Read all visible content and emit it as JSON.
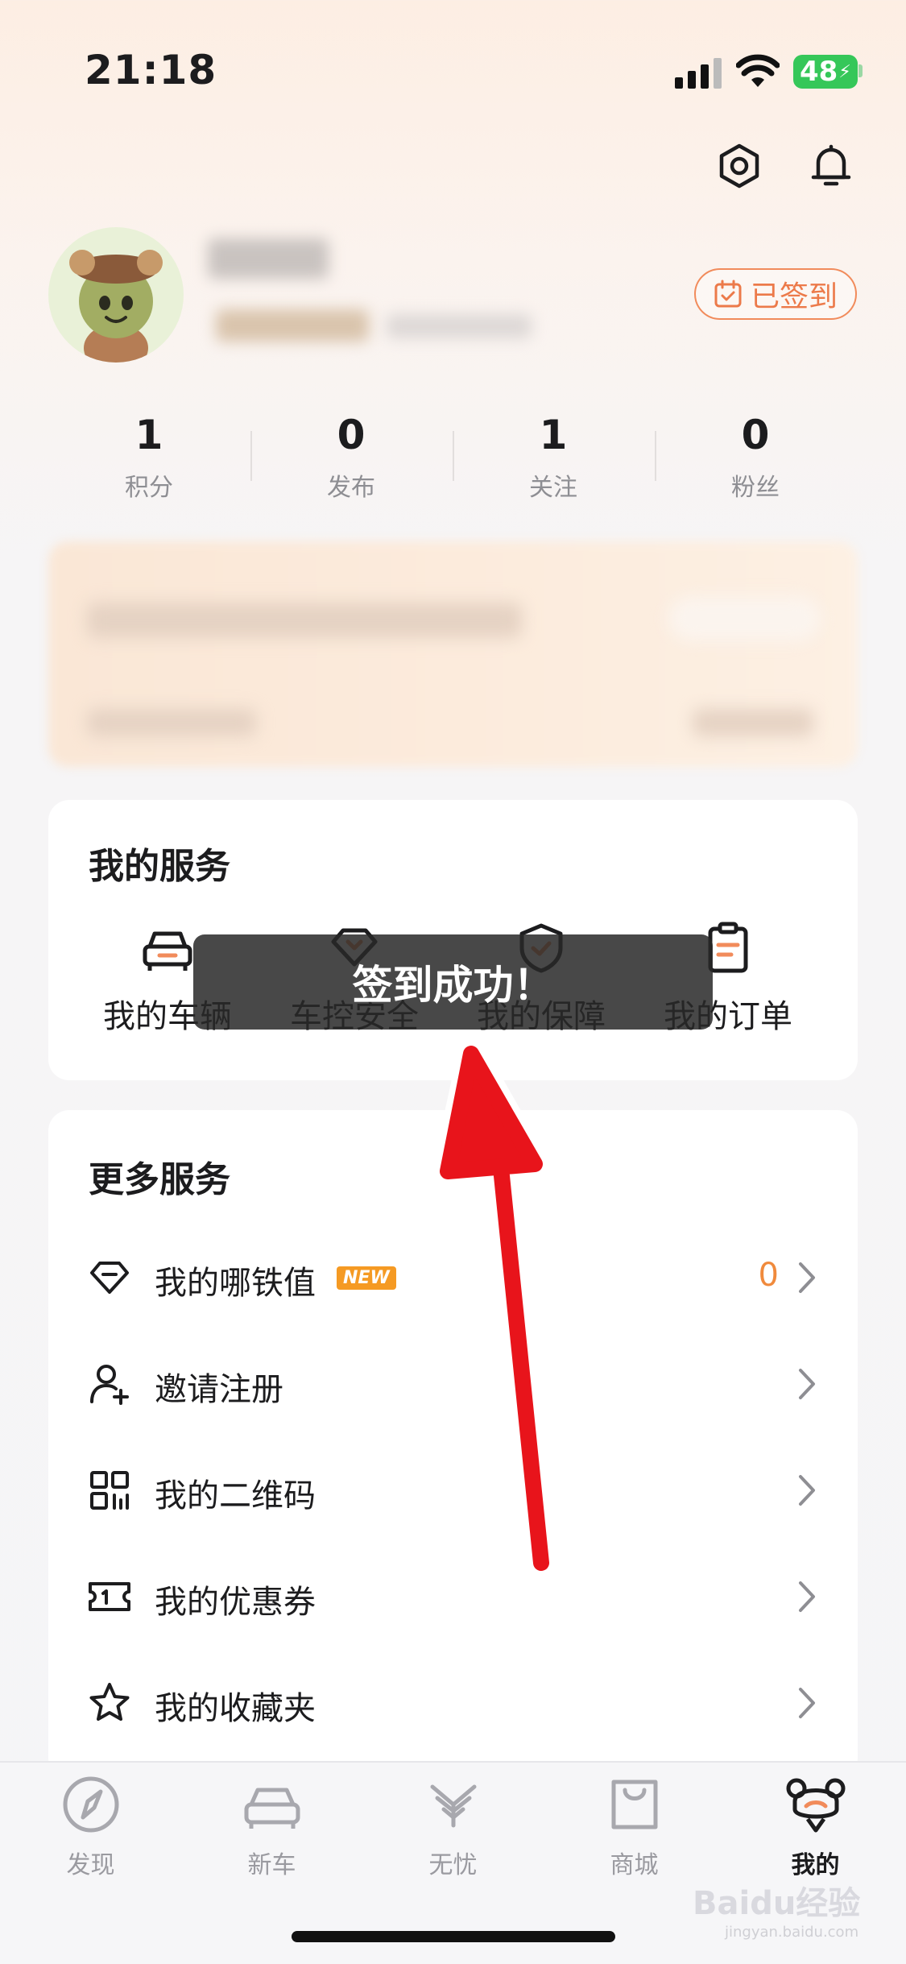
{
  "status_bar": {
    "time": "21:18",
    "battery": "48"
  },
  "profile": {
    "checkin_label": "已签到"
  },
  "stats": [
    {
      "value": "1",
      "label": "积分"
    },
    {
      "value": "0",
      "label": "发布"
    },
    {
      "value": "1",
      "label": "关注"
    },
    {
      "value": "0",
      "label": "粉丝"
    }
  ],
  "my_services": {
    "title": "我的服务",
    "items": [
      {
        "label": "我的车辆",
        "icon": "car-icon"
      },
      {
        "label": "车控安全",
        "icon": "diamond-lock-icon"
      },
      {
        "label": "我的保障",
        "icon": "shield-icon"
      },
      {
        "label": "我的订单",
        "icon": "clipboard-icon"
      }
    ]
  },
  "more_services": {
    "title": "更多服务",
    "items": [
      {
        "label": "我的哪铁值",
        "badge": "NEW",
        "value": "0",
        "icon": "diamond-icon"
      },
      {
        "label": "邀请注册",
        "icon": "add-user-icon"
      },
      {
        "label": "我的二维码",
        "icon": "qr-code-icon"
      },
      {
        "label": "我的优惠券",
        "icon": "ticket-icon"
      },
      {
        "label": "我的收藏夹",
        "icon": "star-icon"
      }
    ]
  },
  "toast": {
    "message": "签到成功！"
  },
  "tab_bar": {
    "items": [
      {
        "label": "发现",
        "icon": "compass-icon"
      },
      {
        "label": "新车",
        "icon": "car-front-icon"
      },
      {
        "label": "无忧",
        "icon": "wings-icon"
      },
      {
        "label": "商城",
        "icon": "shopping-bag-icon"
      },
      {
        "label": "我的",
        "icon": "mascot-icon",
        "active": true
      }
    ]
  },
  "watermark": {
    "text": "Baidu经验",
    "sub": "jingyan.baidu.com"
  },
  "colors": {
    "accent": "#F18B5B",
    "annotation_arrow": "#E8141B",
    "badge": "#F59A23"
  }
}
